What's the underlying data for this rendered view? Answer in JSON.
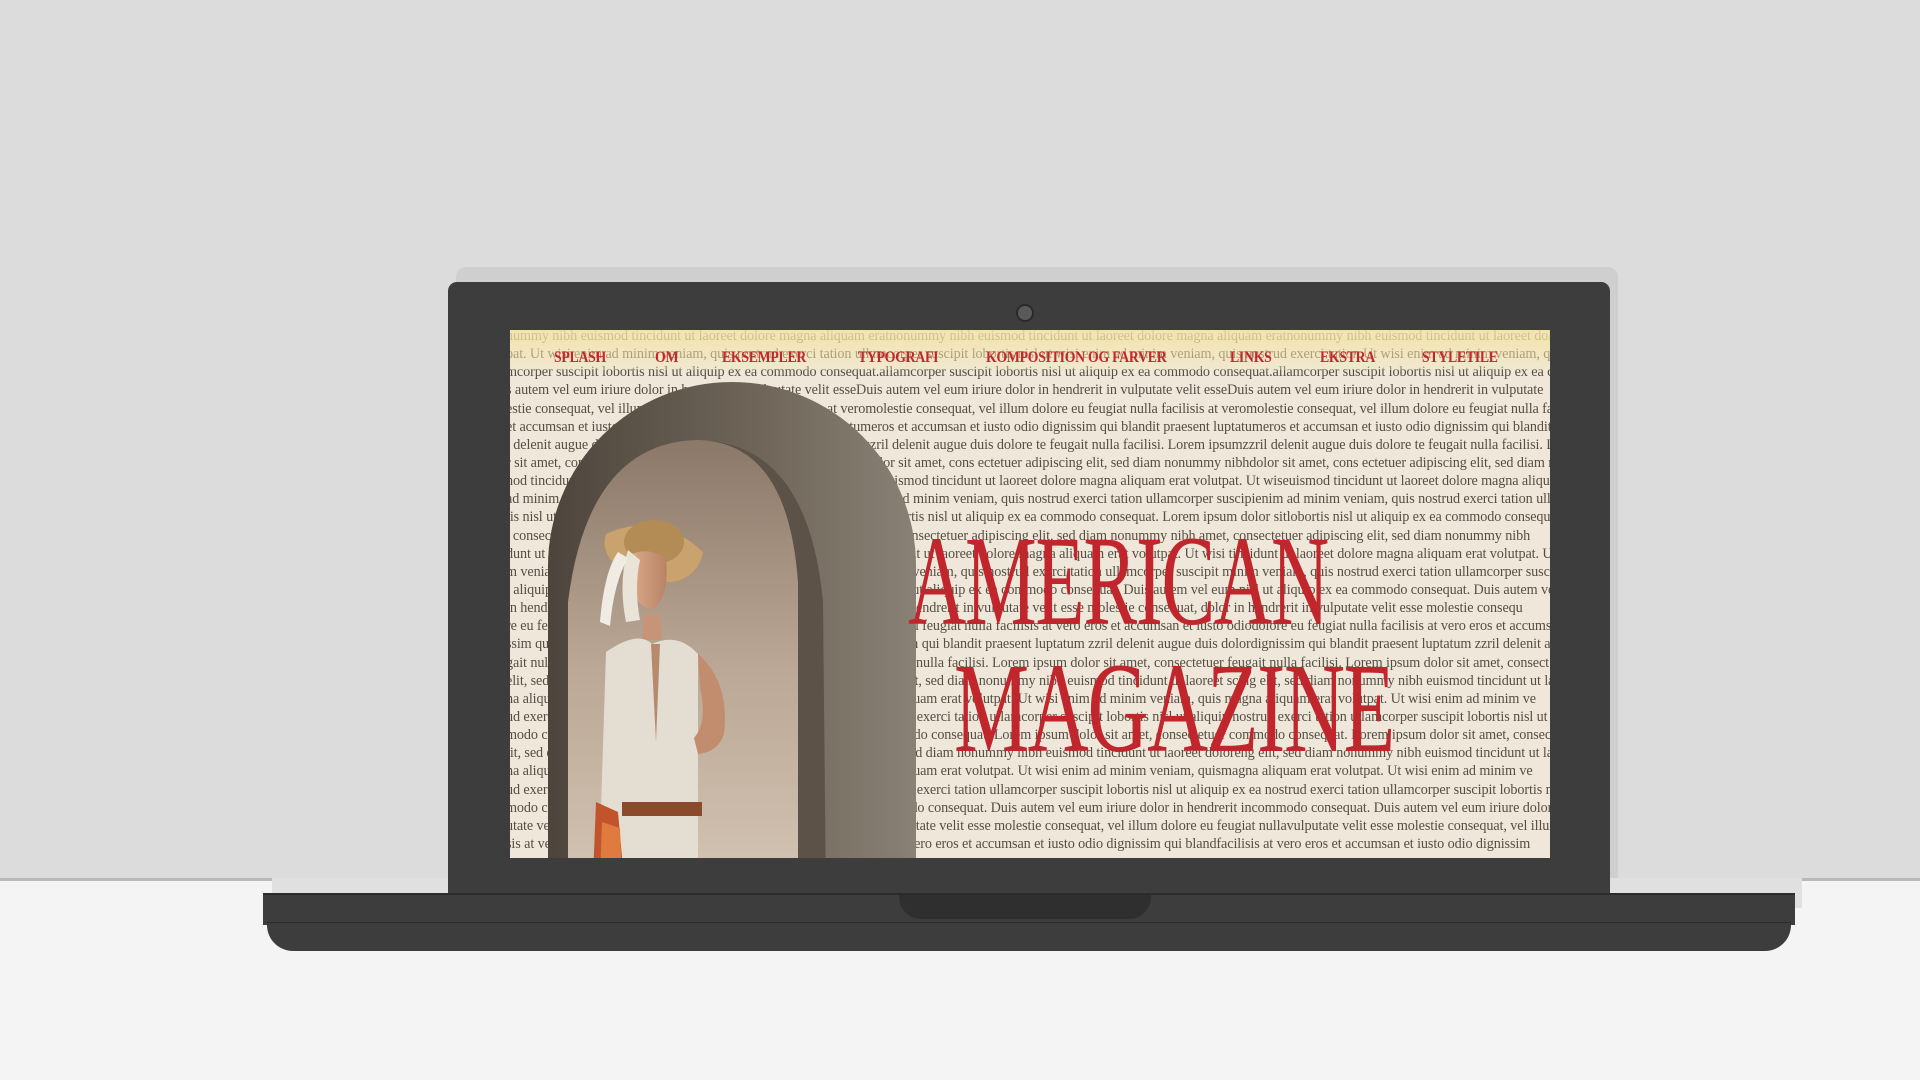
{
  "site": {
    "title_line1": "AMERICAN",
    "title_line2": "MAGAZINE"
  },
  "nav": {
    "items": [
      {
        "label": "SPLASH"
      },
      {
        "label": "OM"
      },
      {
        "label": "EKSEMPLER"
      },
      {
        "label": "TYPOGRAFI"
      },
      {
        "label": "KOMPOSITION OG FARVER"
      },
      {
        "label": "LINKS"
      },
      {
        "label": "EKSTRA"
      },
      {
        "label": "STYLETILE"
      }
    ]
  },
  "background_text": {
    "lines": [
      "nummy nibh euismod tincidunt ut laoreet dolore magna aliquam eratnonummy nibh euismod tincidunt ut laoreet dolore magna aliquam eratnonummy nibh euismod tincidunt ut laoreet dolore magna ali",
      "pat. Ut wisi enim ad minim veniam, quis nostrud exerci tation ullamcorper suscipit lobortis nisl ut wisi enim ad minim veniam, quis nostrud exerci tation Ut wisi enim ad minim veniam, quis nostrud exe",
      "mcorper suscipit lobortis nisl ut aliquip ex ea commodo consequat.allamcorper suscipit lobortis nisl ut aliquip ex ea commodo consequat.allamcorper suscipit lobortis nisl ut aliquip ex ea commodo",
      "s autem vel eum iriure dolor in hendrerit in vulputate velit esseDuis autem vel eum iriure dolor in hendrerit in vulputate velit esseDuis autem vel eum iriure dolor in hendrerit in vulputate",
      "estie consequat, vel illum dolore eu feugiat nulla facilisis at veromolestie consequat, vel illum dolore eu feugiat nulla facilisis at veromolestie consequat, vel illum dolore eu feugiat nulla facil",
      "et accumsan et iusto odio dignissim qui blandit praesent luptatumeros et accumsan et iusto odio dignissim qui blandit praesent luptatumeros et accumsan et iusto odio dignissim qui blandit praesent",
      "l delenit augue duis dolore te feugait nulla facilisi. Lorem ipsumzzril delenit augue duis dolore te feugait nulla facilisi. Lorem ipsumzzril delenit augue duis dolore te feugait nulla facilisi. Lor",
      "r sit amet, cons ectetuer adipiscing elit, sed diam nonummy nibhdolor sit amet, cons ectetuer adipiscing elit, sed diam nonummy nibhdolor sit amet, cons ectetuer adipiscing elit, sed diam nonu",
      "nod tincidunt ut laoreet dolore magna aliquam erat volutpat. Ut wiseuismod tincidunt ut laoreet dolore magna aliquam erat volutpat. Ut wiseuismod tincidunt ut laoreet dolore magna aliquam erat volu",
      "ad minim veniam, quis nostrud exerci tation ullamcorper suscipienim ad minim veniam, quis nostrud exerci tation ullamcorper suscipienim ad minim veniam, quis nostrud exerci tation ullamcorp",
      "tis nisl ut aliquip ex ea commodo consequat. Lorem ipsum dolor sitlobortis nisl ut aliquip ex ea commodo consequat. Lorem ipsum dolor sitlobortis nisl ut aliquip ex ea commodo consequat. Lorem ipsu",
      ", consectetuer adipiscing elit, sed diam nonummy nibh euismod amet, consectetuer adipiscing elit, sed diam nonummy nibh amet, consectetuer adipiscing elit, sed diam nonummy nibh",
      "dunt ut laoreet dolore magna aliquam erat volutpat. Ut wisi enim tincidunt ut laoreet dolore magna aliquam erat volutpat. Ut wisi tincidunt ut laoreet dolore magna aliquam erat volutpat. Ut w",
      "m veniam, quis nostrud exerci tation ullamcorper suscipit lobortisminim veniam, quis nostrud exerci tation ullamcorper suscipit minim veniam, quis nostrud exerci tation ullamcorper susci",
      "l aliquip ex ea commodo consequat. Duis autem vel eum iriure dolornisl ut aliquip ex ea commodo consequat. Duis autem vel eum nisl ut aliquip ex ea commodo consequat. Duis autem ve",
      "in hendrerit in vulputate velit esse molestie consequat, vel illumdolor in hendrerit in vulputate velit esse molestie consequat, dolor in hendrerit in vulputate velit esse molestie consequ",
      "re eu feugiat nulla facilisis at vero eros et accumsan et iusto odiodolore eu feugiat nulla facilisis at vero eros et accumsan et iusto odiodolore eu feugiat nulla facilisis at vero eros et accumsan et",
      "ssim qui blandit praesent luptatum zzril delenit augue duis dolordignissim qui blandit praesent luptatum zzril delenit augue duis dolordignissim qui blandit praesent luptatum zzril delenit augue duis",
      "gait nulla facilisi. Lorem ipsum dolor sit amet, consectetuer adipi-feugait nulla facilisi. Lorem ipsum dolor sit amet, consectetuer feugait nulla facilisi. Lorem ipsum dolor sit amet, consect",
      "elit, sed diam nonummy nibh euismod tincidunt ut laoreet dolorescing elit, sed diam nonummy nibh euismod tincidunt ut laoreet scing elit, sed diam nonummy nibh euismod tincidunt ut lao",
      "na aliquam erat volutpat. Ut wisi enim ad minim veniam, quismagna aliquam erat volutpat. Ut wisi enim ad minim veniam, quis magna aliquam erat volutpat. Ut wisi enim ad minim ve",
      "ud exerci tation ullamcorper suscipit lobortis nisl ut aliquip ex ea nostrud exerci tation ullamcorper suscipit lobortis nisl ut aliquip nostrud exerci tation ullamcorper suscipit lobortis nisl ut al",
      "modo consequat. Lorem ipsum dolor sit amet, consectetuer adipi-commodo consequat. Lorem ipsum dolor sit amet, consectetuer commodo consequat. Lorem ipsum dolor sit amet, consectetu",
      "lit, sed diam nonummy nibh euismod tincidunt ut laoreet doloreng elit, sed diam nonummy nibh euismod tincidunt ut laoreet doloreng elit, sed diam nonummy nibh euismod tincidunt ut lao",
      "na aliquam erat volutpat. Ut wisi enim ad minim veniam, quismagna aliquam erat volutpat. Ut wisi enim ad minim veniam, quismagna aliquam erat volutpat. Ut wisi enim ad minim ve",
      "ud exerci tation ullamcorper suscipit lobortis nisl ut aliquip ex ea nostrud exerci tation ullamcorper suscipit lobortis nisl ut aliquip ex ea nostrud exerci tation ullamcorper suscipit lobortis nisl ut al",
      "modo consequat. Duis autem vel eum iriure dolor in hendrerit in commodo consequat. Duis autem vel eum iriure dolor in hendrerit incommodo consequat. Duis autem vel eum iriure dolor in h",
      "utate velit esse molestie consequat, vel illum dolore eu feugiat nullavulputate velit esse molestie consequat, vel illum dolore eu feugiat nullavulputate velit esse molestie consequat, vel illum dolore eu fe",
      "sis at vero eros et accumsan et iusto odio dignissim qui blandfacilisis at vero eros et accumsan et iusto odio dignissim qui blandfacilisis at vero eros et accumsan et iusto odio dignissim"
    ]
  },
  "colors": {
    "accent_red": "#c1262d",
    "laptop_body": "#3d3d3d",
    "page_background": "#efe7d9",
    "wall": "#dcdcdc",
    "floor": "#f4f4f4"
  },
  "icons": {
    "camera": "webcam-icon"
  }
}
